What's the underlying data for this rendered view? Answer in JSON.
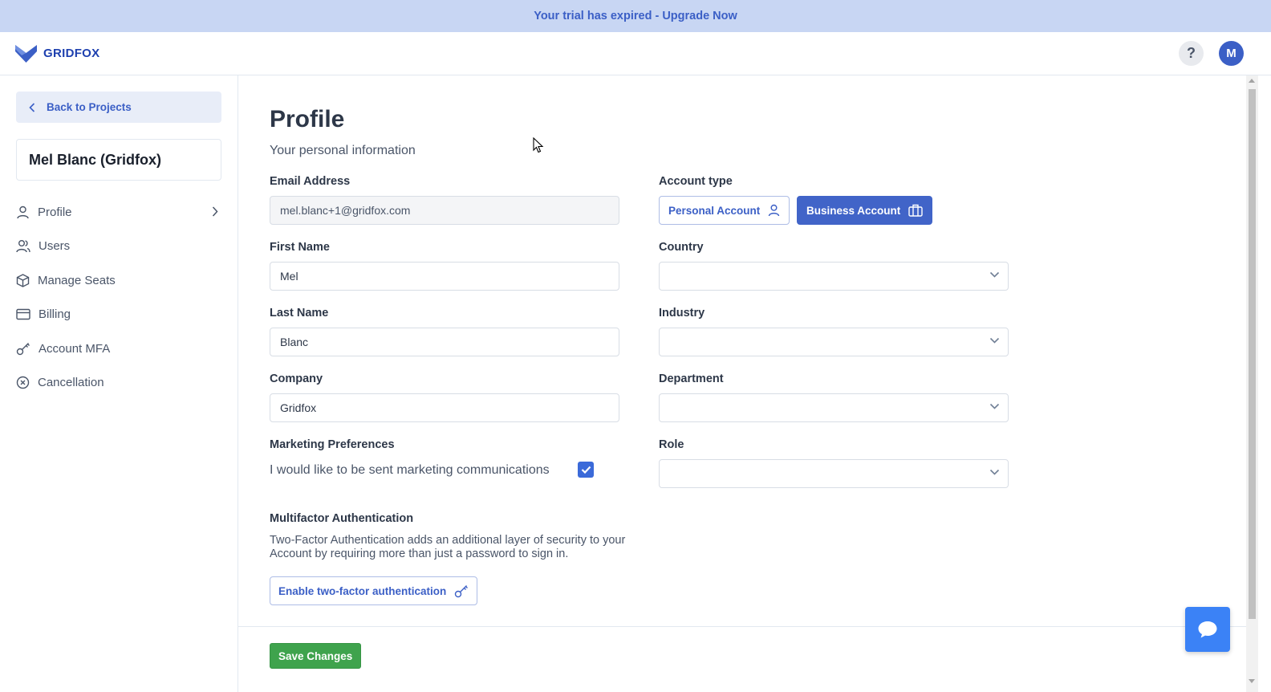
{
  "banner": {
    "text": "Your trial has expired - Upgrade Now"
  },
  "header": {
    "logo_text": "GRIDFOX",
    "help_label": "?",
    "avatar_initial": "M"
  },
  "sidebar": {
    "back_label": "Back to Projects",
    "account_name": "Mel Blanc (Gridfox)",
    "items": [
      {
        "label": "Profile",
        "icon": "user-icon"
      },
      {
        "label": "Users",
        "icon": "users-icon"
      },
      {
        "label": "Manage Seats",
        "icon": "cube-icon"
      },
      {
        "label": "Billing",
        "icon": "credit-card-icon"
      },
      {
        "label": "Account MFA",
        "icon": "key-icon"
      },
      {
        "label": "Cancellation",
        "icon": "x-circle-icon"
      }
    ]
  },
  "profile": {
    "title": "Profile",
    "subtitle": "Your personal information",
    "email": {
      "label": "Email Address",
      "value": "mel.blanc+1@gridfox.com"
    },
    "first_name": {
      "label": "First Name",
      "value": "Mel"
    },
    "last_name": {
      "label": "Last Name",
      "value": "Blanc"
    },
    "company": {
      "label": "Company",
      "value": "Gridfox"
    },
    "marketing": {
      "label": "Marketing Preferences",
      "text": "I would like to be sent marketing communications",
      "checked": true
    },
    "account_type": {
      "label": "Account type",
      "personal_label": "Personal Account",
      "business_label": "Business Account",
      "selected": "Business Account"
    },
    "country": {
      "label": "Country",
      "value": ""
    },
    "industry": {
      "label": "Industry",
      "value": ""
    },
    "department": {
      "label": "Department",
      "value": ""
    },
    "role": {
      "label": "Role",
      "value": ""
    },
    "mfa": {
      "label": "Multifactor Authentication",
      "description": "Two-Factor Authentication adds an additional layer of security to your Account by requiring more than just a password to sign in.",
      "button_label": "Enable two-factor authentication"
    },
    "save_label": "Save Changes"
  },
  "colors": {
    "accent": "#3b5fc6",
    "save": "#3fa34d",
    "banner_bg": "#c8d6f3",
    "chat": "#3b82f6"
  }
}
